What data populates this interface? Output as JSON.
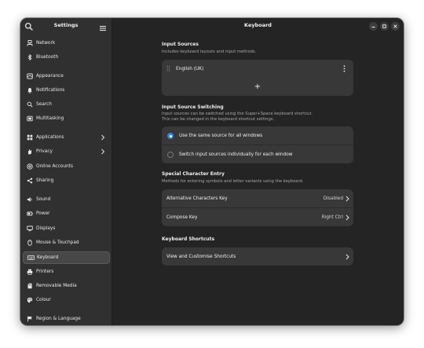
{
  "colors": {
    "window_bg": "#242424",
    "sidebar_bg": "#303030",
    "card_bg": "#383838",
    "accent": "#3584e4"
  },
  "sidebar": {
    "title": "Settings",
    "search_icon": "search-icon",
    "menu_icon": "hamburger-menu-icon",
    "items": [
      {
        "label": "Network",
        "icon": "network-icon"
      },
      {
        "label": "Bluetooth",
        "icon": "bluetooth-icon"
      },
      {
        "label": "Appearance",
        "icon": "appearance-icon"
      },
      {
        "label": "Notifications",
        "icon": "bell-icon"
      },
      {
        "label": "Search",
        "icon": "search-icon"
      },
      {
        "label": "Multitasking",
        "icon": "multitasking-icon"
      },
      {
        "label": "Applications",
        "icon": "applications-icon",
        "has_submenu": true
      },
      {
        "label": "Privacy",
        "icon": "hand-icon",
        "has_submenu": true
      },
      {
        "label": "Online Accounts",
        "icon": "at-icon"
      },
      {
        "label": "Sharing",
        "icon": "share-icon"
      },
      {
        "label": "Sound",
        "icon": "speaker-icon"
      },
      {
        "label": "Power",
        "icon": "power-icon"
      },
      {
        "label": "Displays",
        "icon": "display-icon"
      },
      {
        "label": "Mouse & Touchpad",
        "icon": "mouse-icon"
      },
      {
        "label": "Keyboard",
        "icon": "keyboard-icon",
        "active": true
      },
      {
        "label": "Printers",
        "icon": "printer-icon"
      },
      {
        "label": "Removable Media",
        "icon": "media-icon"
      },
      {
        "label": "Colour",
        "icon": "colour-icon"
      },
      {
        "label": "Region & Language",
        "icon": "flag-icon"
      }
    ]
  },
  "header": {
    "title": "Keyboard"
  },
  "input_sources": {
    "title": "Input Sources",
    "subtitle": "Includes keyboard layouts and input methods.",
    "source_label": "English (UK)",
    "add_label": "+"
  },
  "switching": {
    "title": "Input Source Switching",
    "subtitle_line1": "Input sources can be switched using the Super+Space keyboard shortcut.",
    "subtitle_line2": "This can be changed in the keyboard shortcut settings.",
    "option_same": "Use the same source for all windows",
    "option_individual": "Switch input sources individually for each window",
    "selected": "same"
  },
  "special_chars": {
    "title": "Special Character Entry",
    "subtitle": "Methods for entering symbols and letter variants using the keyboard.",
    "alt_label": "Alternative Characters Key",
    "alt_value": "Disabled",
    "compose_label": "Compose Key",
    "compose_value": "Right Ctrl"
  },
  "shortcuts": {
    "title": "Keyboard Shortcuts",
    "view_label": "View and Customise Shortcuts"
  }
}
